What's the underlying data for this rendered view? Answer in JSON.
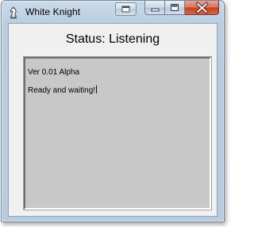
{
  "window": {
    "title": "White Knight",
    "icon": "chess-knight-icon"
  },
  "caption_buttons": {
    "extra": "window-options-icon",
    "minimize": "minimize-icon",
    "maximize": "maximize-icon",
    "close": "close-icon"
  },
  "main": {
    "status": "Status: Listening",
    "log": {
      "lines": [
        "Ver 0.01 Alpha",
        "Ready and waiting!"
      ]
    }
  },
  "colors": {
    "close_button": "#c6401f",
    "log_background": "#c8c8c8",
    "client_background": "#f0f0f0"
  }
}
